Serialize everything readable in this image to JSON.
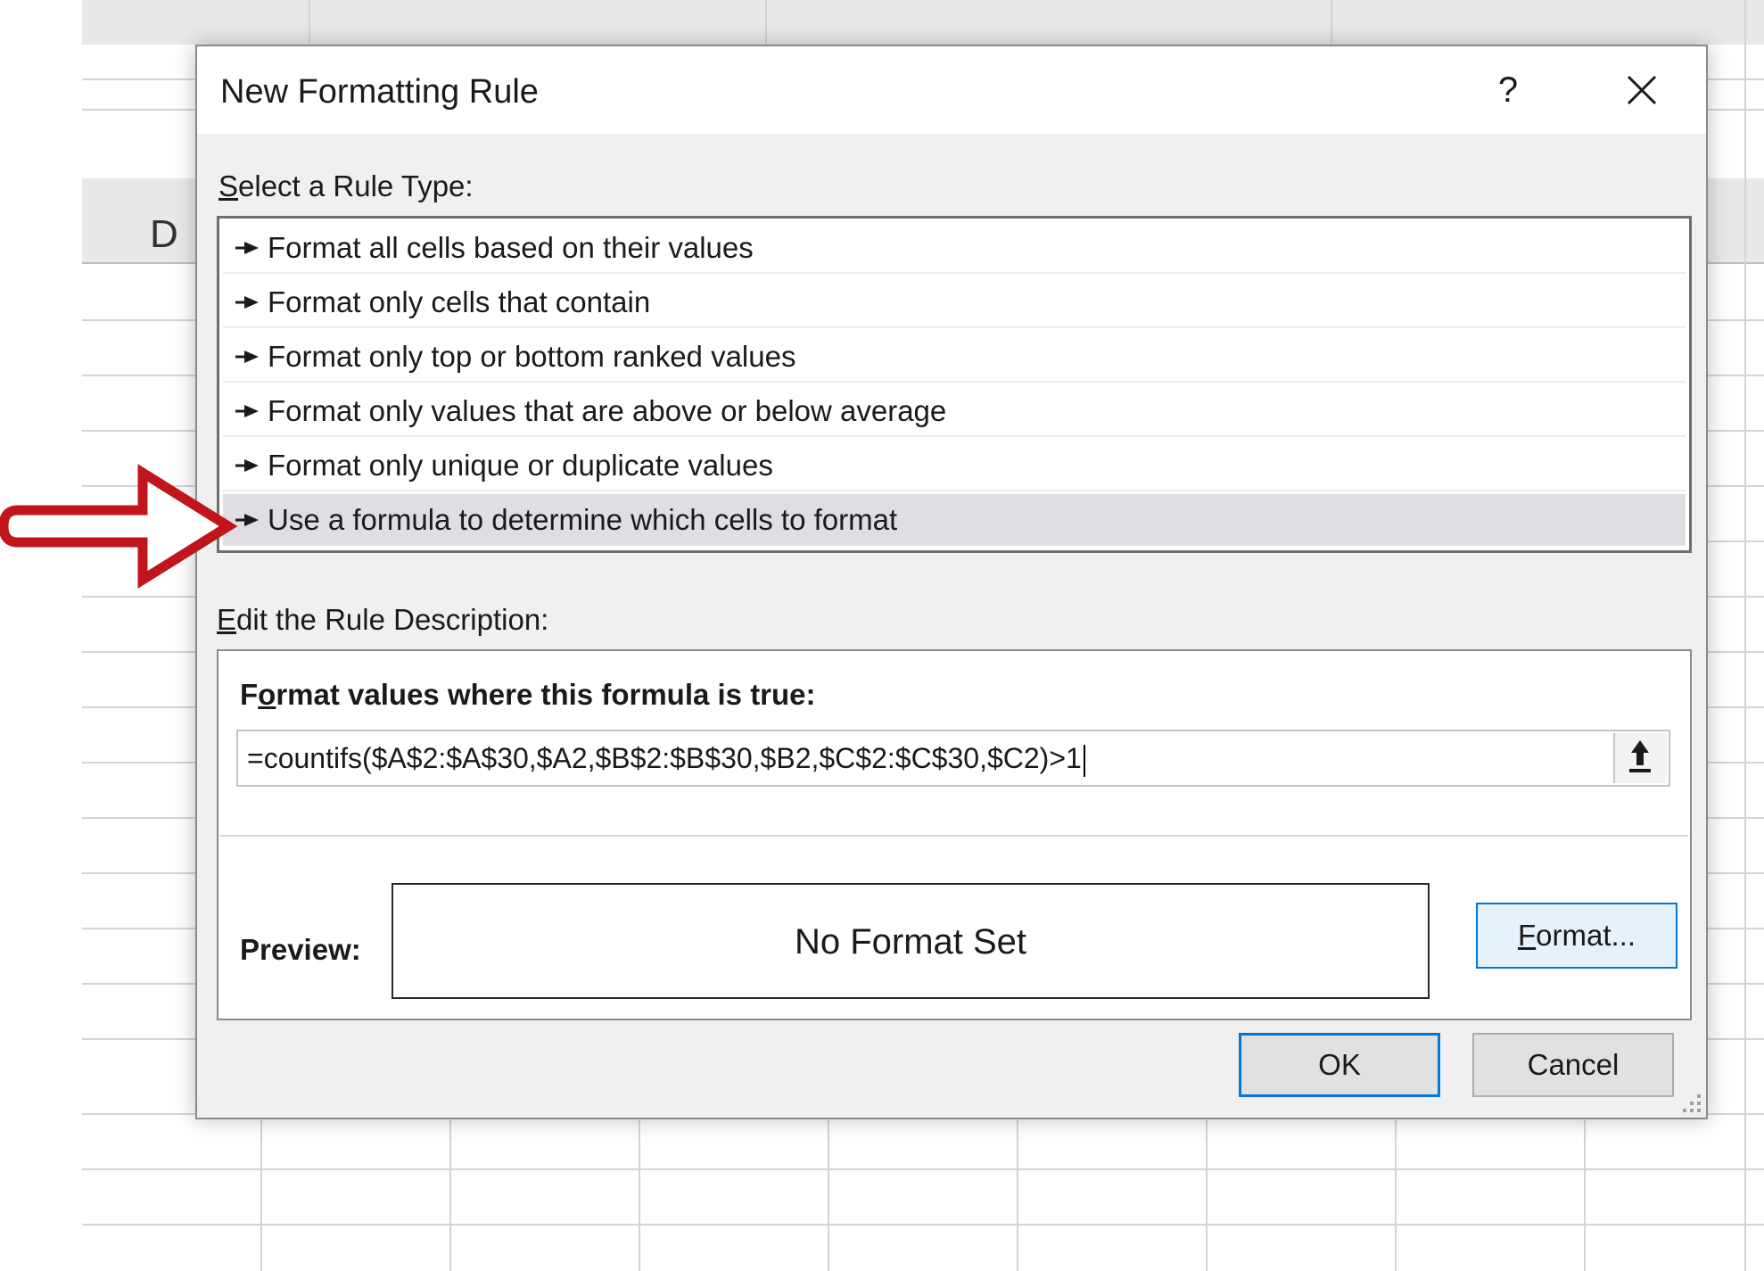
{
  "sheet": {
    "column_letter": "D"
  },
  "dialog": {
    "title": "New Formatting Rule",
    "help_glyph": "?",
    "rule_type_label_key": "S",
    "rule_type_label_rest": "elect a Rule Type:",
    "rule_types": [
      {
        "label": "Format all cells based on their values"
      },
      {
        "label": "Format only cells that contain"
      },
      {
        "label": "Format only top or bottom ranked values"
      },
      {
        "label": "Format only values that are above or below average"
      },
      {
        "label": "Format only unique or duplicate values"
      },
      {
        "label": "Use a formula to determine which cells to format"
      }
    ],
    "selected_rule_index": 5,
    "edit_label_key": "E",
    "edit_label_rest": "dit the Rule Description:",
    "formula_heading_pre": "F",
    "formula_heading_key": "o",
    "formula_heading_rest": "rmat values where this formula is true:",
    "formula_value": "=countifs($A$2:$A$30,$A2,$B$2:$B$30,$B2,$C$2:$C$30,$C2)>1",
    "preview_label": "Preview:",
    "preview_text": "No Format Set",
    "format_button_key": "F",
    "format_button_rest": "ormat...",
    "ok_label": "OK",
    "cancel_label": "Cancel"
  },
  "colors": {
    "accent": "#0078d7",
    "annotation_arrow": "#c0151b",
    "selected_row": "#dedee3"
  },
  "icons": {
    "rule_bullet": "right-triangle-arrow-icon",
    "close": "close-icon",
    "collapse": "collapse-dialog-icon",
    "resize": "resize-grip-icon"
  }
}
